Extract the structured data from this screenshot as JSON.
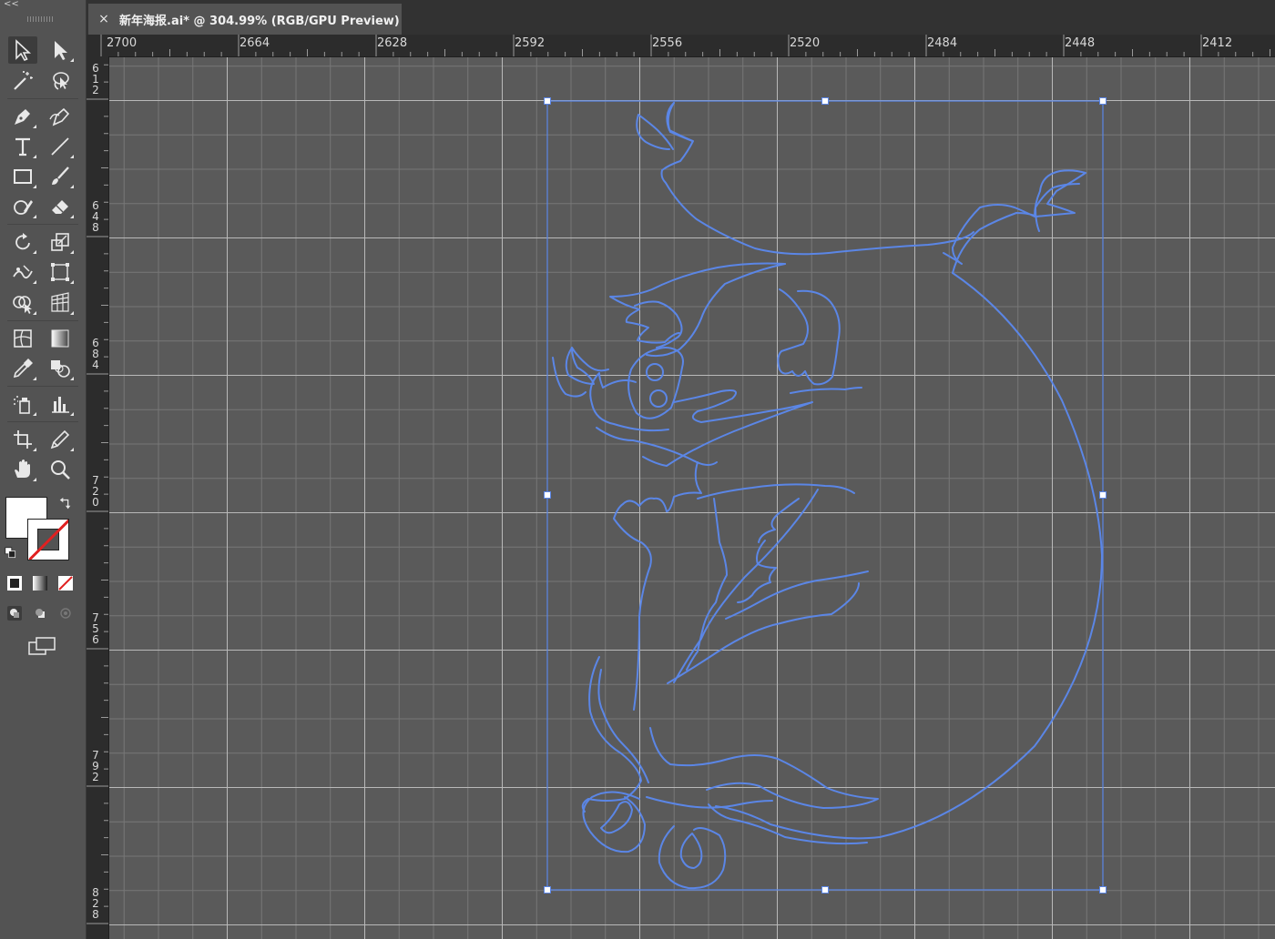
{
  "document_tab": {
    "close_label": "×",
    "title": "新年海报.ai* @ 304.99% (RGB/GPU Preview)"
  },
  "toolbar": {
    "collapse_label": "<<"
  },
  "ruler_top": {
    "labels": [
      "2700",
      "2664",
      "2628",
      "2592",
      "2556",
      "2520",
      "2484",
      "2448",
      "2412"
    ]
  },
  "ruler_left": {
    "labels": [
      "612",
      "648",
      "684",
      "720",
      "756",
      "792",
      "828"
    ]
  },
  "colors": {
    "selection": "#5b86e6",
    "canvas": "#5a5a5a",
    "panel": "#535353",
    "no_stroke_slash": "#e02020"
  },
  "tools": [
    "selection-tool-icon",
    "direct-selection-tool-icon",
    "magic-wand-tool-icon",
    "lasso-tool-icon",
    "pen-tool-icon",
    "curvature-tool-icon",
    "type-tool-icon",
    "line-segment-tool-icon",
    "rectangle-tool-icon",
    "paintbrush-tool-icon",
    "shaper-tool-icon",
    "eraser-tool-icon",
    "rotate-tool-icon",
    "scale-tool-icon",
    "puppet-warp-tool-icon",
    "free-transform-tool-icon",
    "shape-builder-tool-icon",
    "perspective-grid-tool-icon",
    "mesh-tool-icon",
    "gradient-tool-icon",
    "eyedropper-tool-icon",
    "blend-tool-icon",
    "symbol-sprayer-tool-icon",
    "column-graph-tool-icon",
    "artboard-tool-icon",
    "slice-tool-icon",
    "hand-tool-icon",
    "zoom-tool-icon"
  ]
}
